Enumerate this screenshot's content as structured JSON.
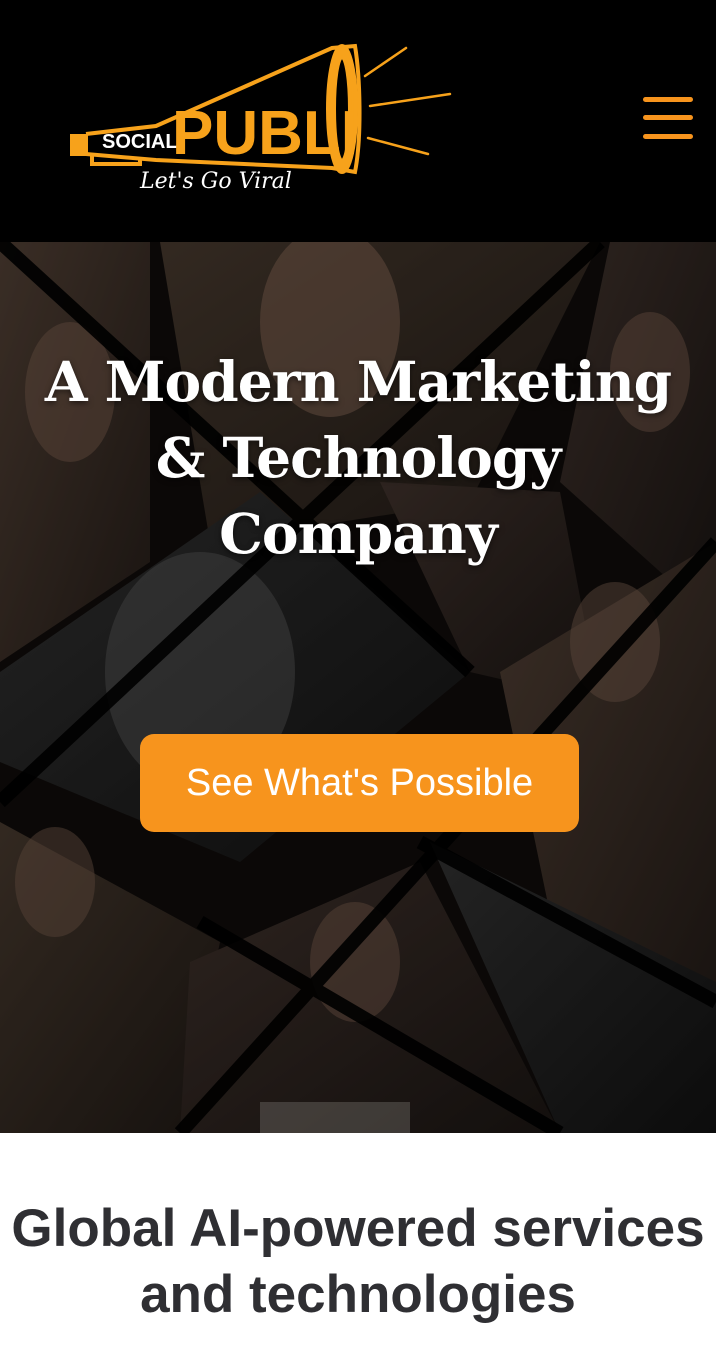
{
  "header": {
    "logo": {
      "small_text": "SOCIAL",
      "big_text": "PUBLI",
      "tagline": "Let's Go Viral",
      "icon": "megaphone-icon"
    },
    "menu": {
      "icon": "hamburger-menu-icon"
    }
  },
  "hero": {
    "title_lines": [
      "A Modern Marketing",
      "& Technology",
      "Company"
    ],
    "cta_label": "See What's Possible",
    "background": "photo-collage-of-influencers"
  },
  "section": {
    "heading_lines": [
      "Global AI-powered services",
      "and technologies"
    ]
  },
  "colors": {
    "accent": "#f7941d",
    "header_bg": "#000000",
    "heading_text": "#2f2f33",
    "page_bg": "#ffffff"
  }
}
